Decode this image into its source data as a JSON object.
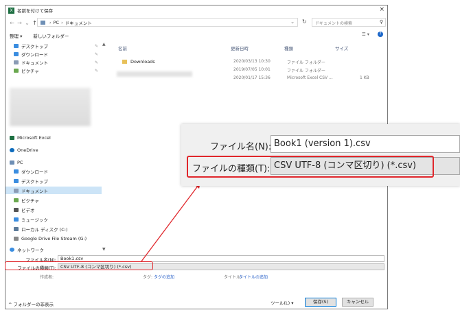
{
  "window": {
    "title": "名前を付けて保存",
    "close_glyph": "×"
  },
  "nav": {
    "back": "←",
    "forward": "→",
    "recent": "⌄",
    "up": "↑",
    "path": [
      "PC",
      "ドキュメント"
    ],
    "path_sep": "›",
    "search_placeholder": "ドキュメントの検索"
  },
  "toolbar": {
    "organize": "整理 ▾",
    "new_folder": "新しいフォルダー",
    "view": "☰ ▾",
    "help": "?"
  },
  "sidebar": {
    "quick_access": [
      {
        "label": "デスクトップ",
        "icon": "desktop-icon",
        "color": "#3a8de0"
      },
      {
        "label": "ダウンロード",
        "icon": "download-icon",
        "color": "#3a8de0"
      },
      {
        "label": "ドキュメント",
        "icon": "documents-icon",
        "color": "#8a9bb5"
      },
      {
        "label": "ピクチャ",
        "icon": "pictures-icon",
        "color": "#6aa84f"
      }
    ],
    "excel": "Microsoft Excel",
    "onedrive": "OneDrive",
    "pc": "PC",
    "pc_items": [
      {
        "label": "ダウンロード",
        "icon": "download-icon",
        "color": "#3a8de0"
      },
      {
        "label": "デスクトップ",
        "icon": "desktop-icon",
        "color": "#3a8de0"
      },
      {
        "label": "ドキュメント",
        "icon": "documents-icon",
        "color": "#8a9bb5"
      },
      {
        "label": "ピクチャ",
        "icon": "pictures-icon",
        "color": "#6aa84f"
      },
      {
        "label": "ビデオ",
        "icon": "videos-icon",
        "color": "#555555"
      },
      {
        "label": "ミュージック",
        "icon": "music-icon",
        "color": "#3a8de0"
      },
      {
        "label": "ローカル ディスク (C:)",
        "icon": "disk-icon",
        "color": "#5b7a99"
      },
      {
        "label": "Google Drive File Stream (G:)",
        "icon": "drive-icon",
        "color": "#888888"
      }
    ],
    "network": "ネットワーク"
  },
  "files": {
    "columns": {
      "name": "名前",
      "date": "更新日時",
      "type": "種類",
      "size": "サイズ"
    },
    "rows": [
      {
        "name": "Downloads",
        "date": "2020/03/13 10:30",
        "type": "ファイル フォルダー",
        "size": ""
      },
      {
        "name": "",
        "date": "2019/07/05 10:01",
        "type": "ファイル フォルダー",
        "size": ""
      },
      {
        "name": "",
        "date": "2020/01/17 15:36",
        "type": "Microsoft Excel CSV ...",
        "size": "1 KB"
      }
    ]
  },
  "form": {
    "filename_label": "ファイル名(N):",
    "filename_value": "Book1.csv",
    "filetype_label": "ファイルの種類(T):",
    "filetype_value": "CSV UTF-8 (コンマ区切り) (*.csv)",
    "author_label": "作成者:",
    "tags_label": "タグ:",
    "tags_link": "タグの追加",
    "title_label": "タイトル:",
    "title_link": "タイトルの追加"
  },
  "footer": {
    "hide_folders": "^ フォルダーの非表示",
    "tools": "ツール(L) ▾",
    "save": "保存(S)",
    "cancel": "キャンセル"
  },
  "zoom": {
    "filename_label": "ファイル名(N):",
    "filename_value": "Book1 (version 1).csv",
    "filetype_label": "ファイルの種類(T):",
    "filetype_value": "CSV UTF-8 (コンマ区切り) (*.csv)"
  },
  "colors": {
    "highlight": "#e0262b",
    "selected": "#cce4f7",
    "excel_green": "#1d6f42",
    "link": "#2a62c9"
  }
}
